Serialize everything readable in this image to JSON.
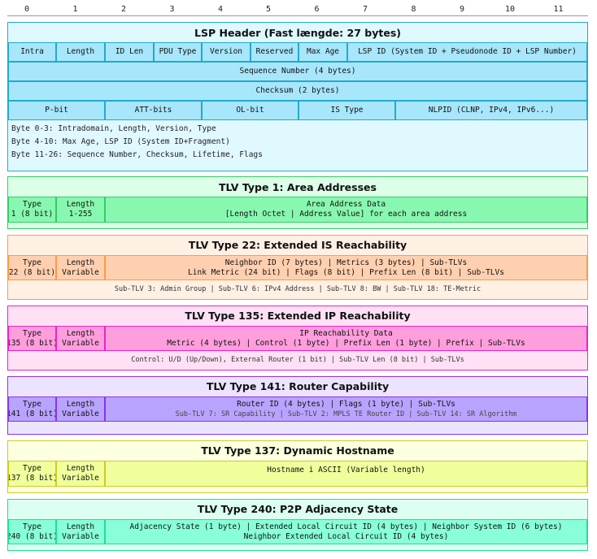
{
  "ruler": [
    "0",
    "1",
    "2",
    "3",
    "4",
    "5",
    "6",
    "7",
    "8",
    "9",
    "10",
    "11"
  ],
  "lsp": {
    "title": "LSP Header (Fast længde: 27 bytes)",
    "row1": [
      "Intra",
      "Length",
      "ID Len",
      "PDU Type",
      "Version",
      "Reserved",
      "Max Age",
      "LSP ID (System ID + Pseudonode ID + LSP Number)"
    ],
    "row2": "Sequence Number (4 bytes)",
    "row3": "Checksum (2 bytes)",
    "row4": [
      "P-bit",
      "ATT-bits",
      "OL-bit",
      "IS Type",
      "NLPID (CLNP, IPv4, IPv6...)"
    ],
    "notes": [
      "Byte 0-3: Intradomain, Length, Version, Type",
      "Byte 4-10: Max Age, LSP ID (System ID+Fragment)",
      "Byte 11-26: Sequence Number, Checksum, Lifetime, Flags"
    ]
  },
  "tlv1": {
    "title": "TLV Type 1: Area Addresses",
    "type": [
      "Type",
      "1 (8 bit)"
    ],
    "length": [
      "Length",
      "1-255"
    ],
    "data": [
      "Area Address Data",
      "[Length Octet | Address Value] for each area address"
    ]
  },
  "tlv22": {
    "title": "TLV Type 22: Extended IS Reachability",
    "type": [
      "Type",
      "22 (8 bit)"
    ],
    "length": [
      "Length",
      "Variable"
    ],
    "data": [
      "Neighbor ID (7 bytes) | Metrics (3 bytes) | Sub-TLVs",
      "Link Metric (24 bit) | Flags (8 bit) | Prefix Len (8 bit) | Sub-TLVs"
    ],
    "note": "Sub-TLV 3: Admin Group | Sub-TLV 6: IPv4 Address | Sub-TLV 8: BW | Sub-TLV 18: TE-Metric"
  },
  "tlv135": {
    "title": "TLV Type 135: Extended IP Reachability",
    "type": [
      "Type",
      "135 (8 bit)"
    ],
    "length": [
      "Length",
      "Variable"
    ],
    "data": [
      "IP Reachability Data",
      "Metric (4 bytes) | Control (1 byte) | Prefix Len (1 byte) | Prefix | Sub-TLVs"
    ],
    "note": "Control: U/D (Up/Down), External Router (1 bit) | Sub-TLV Len (8 bit) | Sub-TLVs"
  },
  "tlv141": {
    "title": "TLV Type 141: Router Capability",
    "type": [
      "Type",
      "141 (8 bit)"
    ],
    "length": [
      "Length",
      "Variable"
    ],
    "data": [
      "Router ID (4 bytes) | Flags (1 byte) | Sub-TLVs",
      "Sub-TLV 7: SR Capability | Sub-TLV 2: MPLS TE Router ID | Sub-TLV 14: SR Algorithm"
    ]
  },
  "tlv137": {
    "title": "TLV Type 137: Dynamic Hostname",
    "type": [
      "Type",
      "137 (8 bit)"
    ],
    "length": [
      "Length",
      "Variable"
    ],
    "data": [
      "Hostname i ASCII (Variable length)"
    ]
  },
  "tlv240": {
    "title": "TLV Type 240: P2P Adjacency State",
    "type": [
      "Type",
      "240 (8 bit)"
    ],
    "length": [
      "Length",
      "Variable"
    ],
    "data": [
      "Adjacency State (1 byte) | Extended Local Circuit ID (4 bytes) | Neighbor System ID (6 bytes)",
      "Neighbor Extended Local Circuit ID (4 bytes)"
    ]
  },
  "colors": {
    "lsp_border": "#22aacc",
    "lsp_bg": "#e0f8ff",
    "lsp_cell": "#a8e6fb",
    "tlv1_border": "#33cc66",
    "tlv1_bg": "#dcffe8",
    "tlv1_cell": "#88f8b0",
    "tlv22_border": "#ff9944",
    "tlv22_bg": "#fff0e4",
    "tlv22_cell": "#ffd0b0",
    "tlv135_border": "#ee22cc",
    "tlv135_bg": "#ffe0f4",
    "tlv135_cell": "#ff9edc",
    "tlv141_border": "#8833ee",
    "tlv141_bg": "#ece4ff",
    "tlv141_cell": "#b8a4ff",
    "tlv137_border": "#cccc22",
    "tlv137_bg": "#fcffe0",
    "tlv137_cell": "#f0ff9c",
    "tlv240_border": "#22dd99",
    "tlv240_bg": "#dcfff2",
    "tlv240_cell": "#88ffd8"
  }
}
